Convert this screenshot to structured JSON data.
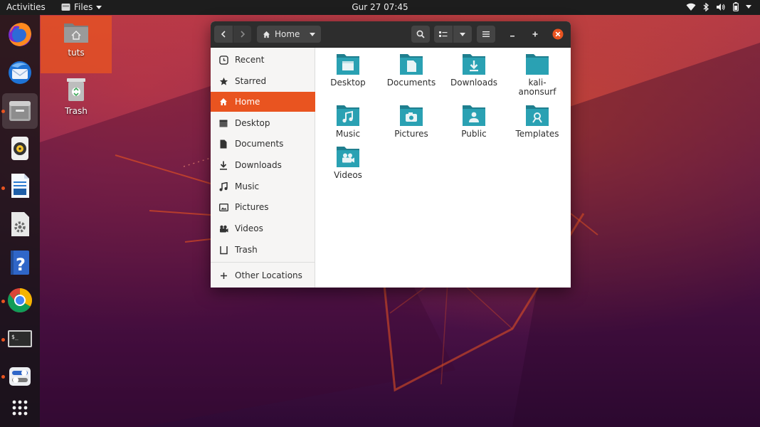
{
  "topbar": {
    "activities": "Activities",
    "app_menu": "Files",
    "clock": "Gur 27  07:45"
  },
  "dock": {
    "apps": [
      {
        "icon": "firefox-icon",
        "running": false
      },
      {
        "icon": "thunderbird-icon",
        "running": false
      },
      {
        "icon": "files-icon",
        "running": true,
        "active": true
      },
      {
        "icon": "rhythmbox-icon",
        "running": false
      },
      {
        "icon": "writer-icon",
        "running": true
      },
      {
        "icon": "software-icon",
        "running": false
      },
      {
        "icon": "help-icon",
        "running": false
      },
      {
        "icon": "chrome-icon",
        "running": true
      },
      {
        "icon": "terminal-icon",
        "running": true
      },
      {
        "icon": "settings-icon",
        "running": true
      },
      {
        "icon": "app-grid-icon",
        "running": false
      }
    ]
  },
  "desktop": {
    "icons": [
      {
        "label": "tuts",
        "icon": "home-folder-icon",
        "selected": true
      },
      {
        "label": "Trash",
        "icon": "trash-icon",
        "selected": false
      }
    ]
  },
  "window": {
    "path_button": "Home",
    "sidebar": {
      "items": [
        {
          "label": "Recent",
          "icon": "clock-icon"
        },
        {
          "label": "Starred",
          "icon": "star-icon"
        },
        {
          "label": "Home",
          "icon": "home-icon",
          "active": true
        },
        {
          "label": "Desktop",
          "icon": "desktop-icon"
        },
        {
          "label": "Documents",
          "icon": "document-icon"
        },
        {
          "label": "Downloads",
          "icon": "download-icon"
        },
        {
          "label": "Music",
          "icon": "music-icon"
        },
        {
          "label": "Pictures",
          "icon": "picture-icon"
        },
        {
          "label": "Videos",
          "icon": "video-icon"
        },
        {
          "label": "Trash",
          "icon": "trash-icon"
        }
      ],
      "other_locations": "Other Locations"
    },
    "files": [
      {
        "label": "Desktop",
        "icon": "folder-desktop-icon"
      },
      {
        "label": "Documents",
        "icon": "folder-documents-icon"
      },
      {
        "label": "Downloads",
        "icon": "folder-downloads-icon"
      },
      {
        "label": "kali-anonsurf",
        "label_line1": "kali-",
        "label_line2": "anonsurf",
        "icon": "folder-icon"
      },
      {
        "label": "Music",
        "icon": "folder-music-icon"
      },
      {
        "label": "Pictures",
        "icon": "folder-pictures-icon"
      },
      {
        "label": "Public",
        "icon": "folder-public-icon"
      },
      {
        "label": "Templates",
        "icon": "folder-templates-icon"
      },
      {
        "label": "Videos",
        "icon": "folder-videos-icon"
      }
    ]
  },
  "colors": {
    "accent": "#e95420",
    "folder": "#2aa1b3",
    "folder_dark": "#1f7f8f"
  }
}
